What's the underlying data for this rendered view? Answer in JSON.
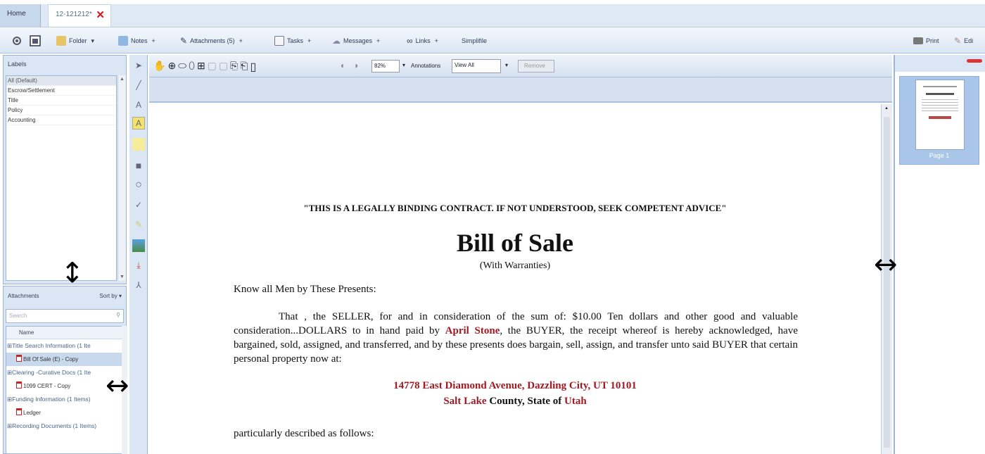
{
  "tabs": {
    "home": "Home",
    "doc": "12-121212*",
    "close": "✕"
  },
  "toolbar": {
    "folder": "Folder",
    "notes": "Notes",
    "attachments": "Attachments (5)",
    "tasks": "Tasks",
    "messages": "Messages",
    "links": "Links",
    "simplifile": "Simplifile",
    "print": "Print",
    "edit": "Edi"
  },
  "labels": {
    "title": "Labels",
    "items": [
      "All (Default)",
      "Escrow/Settlement",
      "Title",
      "Policy",
      "Accounting"
    ]
  },
  "attachments": {
    "title": "Attachments",
    "sort": "Sort by",
    "search_placeholder": "Search",
    "col_name": "Name",
    "rows": [
      {
        "kind": "group",
        "text": "Title Search Information (1 Ite"
      },
      {
        "kind": "file",
        "text": "Bill Of Sale (E) - Copy",
        "selected": true
      },
      {
        "kind": "group",
        "text": "Clearing -Curative Docs (1 Ite"
      },
      {
        "kind": "file",
        "text": "1099 CERT - Copy"
      },
      {
        "kind": "group",
        "text": "Funding Information (1 Items)"
      },
      {
        "kind": "file",
        "text": "Ledger"
      },
      {
        "kind": "group",
        "text": "Recording Documents (1 Items)"
      }
    ]
  },
  "viewer": {
    "zoom": "82%",
    "annotations_label": "Annotations",
    "annotations_value": "View All",
    "remove": "Remove"
  },
  "thumbnail": {
    "label": "Page 1"
  },
  "document": {
    "notice": "\"THIS IS A LEGALLY BINDING CONTRACT.  IF NOT UNDERSTOOD, SEEK COMPETENT ADVICE\"",
    "title": "Bill of Sale",
    "subtitle": "(With Warranties)",
    "know": "Know all Men by These Presents:",
    "p_part1": "That  , the SELLER, for and in consideration of the sum of: $10.00 Ten dollars and other good and valuable consideration...DOLLARS to           in hand paid by ",
    "buyer": "April Stone",
    "p_part2": ", the BUYER, the receipt whereof is hereby acknowledged, have bargained, sold, assigned, and transferred, and by these presents does bargain, sell, assign, and transfer unto said BUYER that certain personal property now at:",
    "address": "14778 East Diamond Avenue, Dazzling City, UT  10101",
    "county": "Salt Lake",
    "county_suffix": " County, State of ",
    "state": "Utah",
    "particular": "particularly described as follows:"
  },
  "arrows": {
    "vertical": "↕",
    "horizontal": "↔"
  }
}
